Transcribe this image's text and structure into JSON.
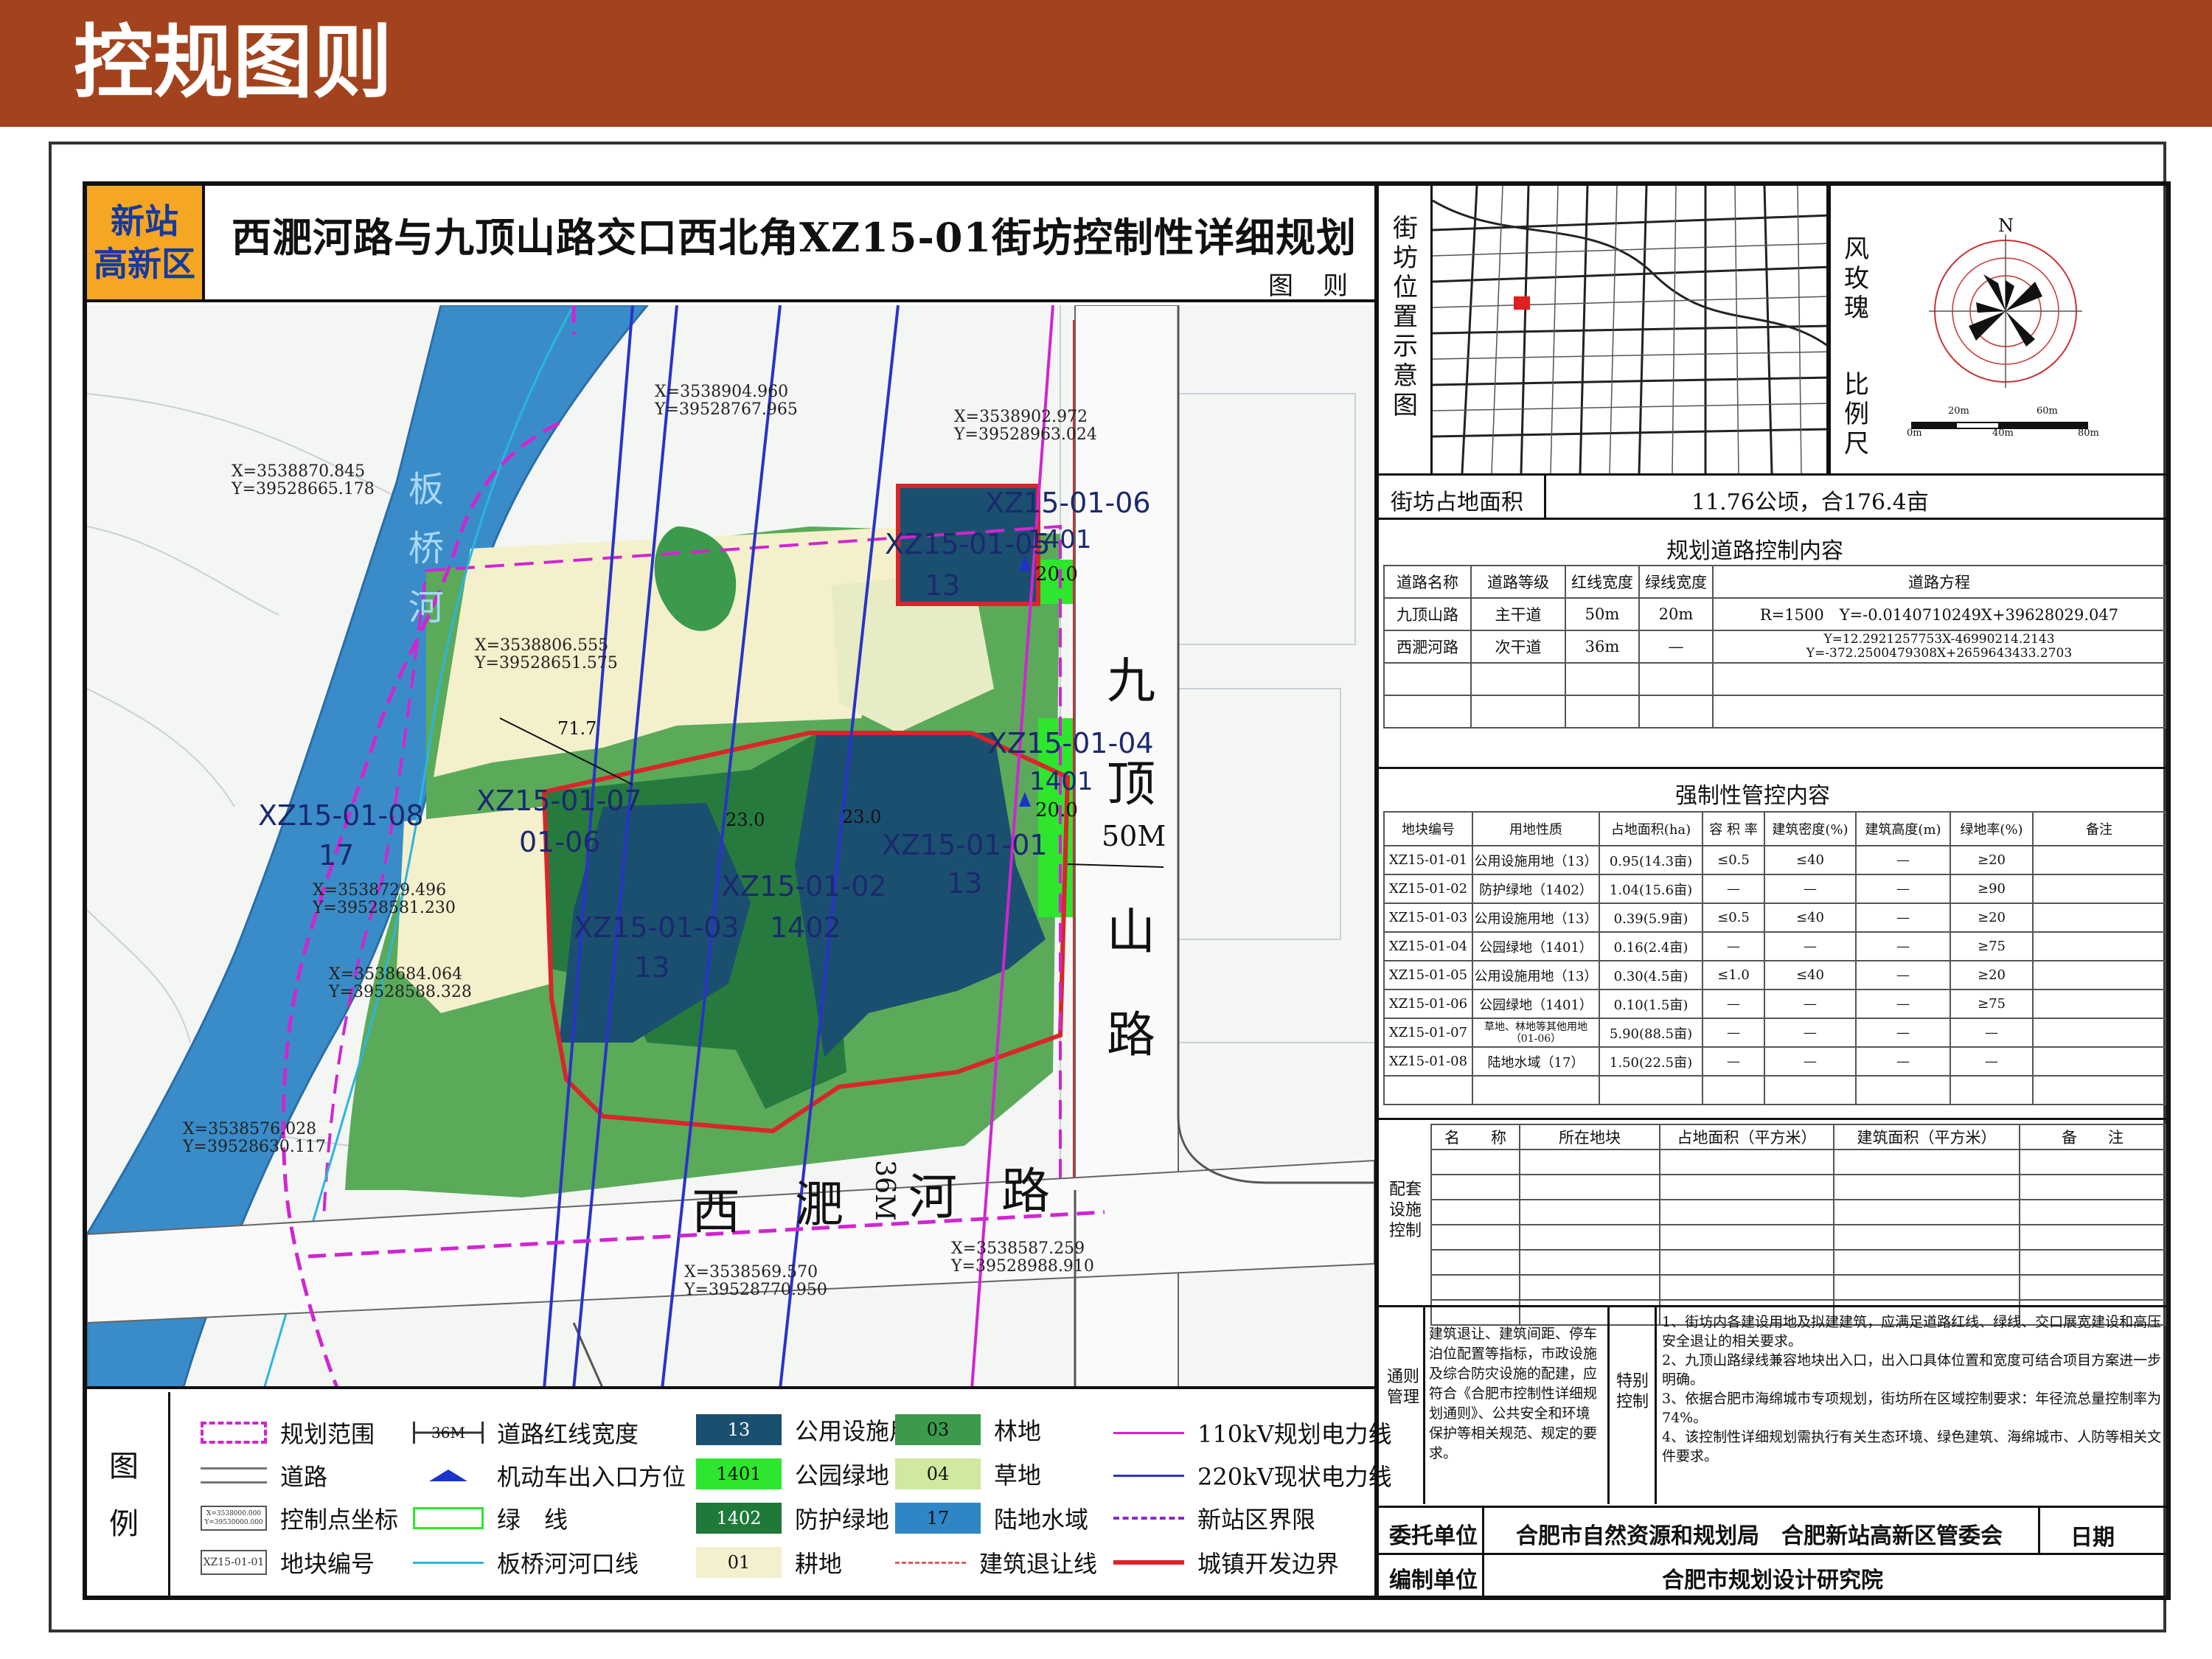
{
  "header": {
    "title": "控规图则"
  },
  "plan": {
    "badge_line1": "新站",
    "badge_line2": "高新区",
    "title": "西淝河路与九顶山路交口西北角XZ15-01街坊控制性详细规划",
    "subtitle": "图则"
  },
  "map": {
    "river_name": [
      "板",
      "桥",
      "河"
    ],
    "road_east": [
      "九",
      "顶",
      "山",
      "路"
    ],
    "road_east_width": "50M",
    "road_south": [
      "西",
      "淝",
      "河",
      "路"
    ],
    "road_south_width": "36M",
    "zones": [
      {
        "code": "XZ15-01-01",
        "use": "13"
      },
      {
        "code": "XZ15-01-02",
        "use": "1402"
      },
      {
        "code": "XZ15-01-03",
        "use": "13"
      },
      {
        "code": "XZ15-01-04",
        "use": "1401"
      },
      {
        "code": "XZ15-01-05",
        "use": "13"
      },
      {
        "code": "XZ15-01-06",
        "use": "1401"
      },
      {
        "code": "XZ15-01-07",
        "use": "01-06"
      },
      {
        "code": "XZ15-01-08",
        "use": "17"
      }
    ],
    "dims": [
      "20.0",
      "20.0",
      "23.0",
      "23.0",
      "71.7"
    ],
    "coords": [
      {
        "x": "X=3538904.960",
        "y": "Y=39528767.965"
      },
      {
        "x": "X=3538902.972",
        "y": "Y=39528963.024"
      },
      {
        "x": "X=3538870.845",
        "y": "Y=39528665.178"
      },
      {
        "x": "X=3538806.555",
        "y": "Y=39528651.575"
      },
      {
        "x": "X=3538729.496",
        "y": "Y=39528581.230"
      },
      {
        "x": "X=3538684.064",
        "y": "Y=39528588.328"
      },
      {
        "x": "X=3538576.028",
        "y": "Y=39528630.117"
      },
      {
        "x": "X=3538569.570",
        "y": "Y=39528770.950"
      },
      {
        "x": "X=3538587.259",
        "y": "Y=39528988.910"
      }
    ]
  },
  "legend": {
    "title": [
      "图",
      "例"
    ],
    "items": [
      {
        "label": "规划范围",
        "swatch": "dashed-magenta"
      },
      {
        "label": "道路",
        "swatch": "road"
      },
      {
        "label": "控制点坐标",
        "swatch": "coord",
        "text": "X=3538000.000 Y=39530000.000"
      },
      {
        "label": "地块编号",
        "swatch": "code",
        "text": "XZ15-01-01"
      },
      {
        "label": "道路红线宽度",
        "swatch": "width",
        "text": "36M"
      },
      {
        "label": "机动车出入口方位",
        "swatch": "entrance"
      },
      {
        "label": "绿　线",
        "swatch": "greenline"
      },
      {
        "label": "板桥河河口线",
        "swatch": "riverline"
      },
      {
        "label": "公用设施用地",
        "swatch": "fill",
        "text": "13",
        "color": "#1b4f70"
      },
      {
        "label": "公园绿地",
        "swatch": "fill",
        "text": "1401",
        "color": "#2ee62e"
      },
      {
        "label": "防护绿地",
        "swatch": "fill",
        "text": "1402",
        "color": "#1f7a3a"
      },
      {
        "label": "耕地",
        "swatch": "fill",
        "text": "01",
        "color": "#f3f0cd"
      },
      {
        "label": "林地",
        "swatch": "fill",
        "text": "03",
        "color": "#3c9a4c"
      },
      {
        "label": "草地",
        "swatch": "fill",
        "text": "04",
        "color": "#cfe9a0"
      },
      {
        "label": "陆地水域",
        "swatch": "fill",
        "text": "17",
        "color": "#2f86c6"
      },
      {
        "label": "建筑退让线",
        "swatch": "setback"
      },
      {
        "label": "110kV规划电力线",
        "swatch": "power110"
      },
      {
        "label": "220kV现状电力线",
        "swatch": "power220"
      },
      {
        "label": "新站区界限",
        "swatch": "boundary"
      },
      {
        "label": "城镇开发边界",
        "swatch": "devline"
      }
    ]
  },
  "location": {
    "label": [
      "街",
      "坊",
      "位",
      "置",
      "示",
      "意",
      "图"
    ],
    "windrose_label": [
      "风",
      "玫",
      "瑰"
    ],
    "north": "N",
    "scale_label": [
      "比",
      "例",
      "尺"
    ],
    "scale_ticks": [
      "0m",
      "20m",
      "40m",
      "60m",
      "80m"
    ]
  },
  "area": {
    "label": "街坊占地面积",
    "value": "11.76公顷，合176.4亩"
  },
  "roads": {
    "title": "规划道路控制内容",
    "headers": [
      "道路名称",
      "道路等级",
      "红线宽度",
      "绿线宽度",
      "道路方程"
    ],
    "rows": [
      [
        "九顶山路",
        "主干道",
        "50m",
        "20m",
        "R=1500　Y=-0.0140710249X+39628029.047"
      ],
      [
        "西淝河路",
        "次干道",
        "36m",
        "—",
        "Y=12.2921257753X-46990214.2143 Y=-372.2500479308X+2659643433.2703"
      ]
    ]
  },
  "mandatory": {
    "title": "强制性管控内容",
    "headers": [
      "地块编号",
      "用地性质",
      "占地面积(ha)",
      "容 积 率",
      "建筑密度(%)",
      "建筑高度(m)",
      "绿地率(%)",
      "备注"
    ],
    "rows": [
      [
        "XZ15-01-01",
        "公用设施用地（13）",
        "0.95(14.3亩)",
        "≤0.5",
        "≤40",
        "—",
        "≥20",
        ""
      ],
      [
        "XZ15-01-02",
        "防护绿地（1402）",
        "1.04(15.6亩)",
        "—",
        "—",
        "—",
        "≥90",
        ""
      ],
      [
        "XZ15-01-03",
        "公用设施用地（13）",
        "0.39(5.9亩)",
        "≤0.5",
        "≤40",
        "—",
        "≥20",
        ""
      ],
      [
        "XZ15-01-04",
        "公园绿地（1401）",
        "0.16(2.4亩)",
        "—",
        "—",
        "—",
        "≥75",
        ""
      ],
      [
        "XZ15-01-05",
        "公用设施用地（13）",
        "0.30(4.5亩)",
        "≤1.0",
        "≤40",
        "—",
        "≥20",
        ""
      ],
      [
        "XZ15-01-06",
        "公园绿地（1401）",
        "0.10(1.5亩)",
        "—",
        "—",
        "—",
        "≥75",
        ""
      ],
      [
        "XZ15-01-07",
        "草地、林地等其他用地（01-06）",
        "5.90(88.5亩)",
        "—",
        "—",
        "—",
        "—",
        ""
      ],
      [
        "XZ15-01-08",
        "陆地水域（17）",
        "1.50(22.5亩)",
        "—",
        "—",
        "—",
        "—",
        ""
      ]
    ]
  },
  "facilities": {
    "label": [
      "配套",
      "设施",
      "控制"
    ],
    "headers": [
      "名　　称",
      "所在地块",
      "占地面积（平方米）",
      "建筑面积（平方米）",
      "备　　注"
    ]
  },
  "general": {
    "label": [
      "通则",
      "管理"
    ],
    "text": "建筑退让、建筑间距、停车泊位配置等指标，市政设施及综合防灾设施的配建，应符合《合肥市控制性详细规划通则》、公共安全和环境保护等相关规范、规定的要求。"
  },
  "special": {
    "label": [
      "特别",
      "控制"
    ],
    "items": [
      "1、街坊内各建设用地及拟建建筑，应满足道路红线、绿线、交口展宽建设和高压安全退让的相关要求。",
      "2、九顶山路绿线兼容地块出入口，出入口具体位置和宽度可结合项目方案进一步明确。",
      "3、依据合肥市海绵城市专项规划，街坊所在区域控制要求：年径流总量控制率为74%。",
      "4、该控制性详细规划需执行有关生态环境、绿色建筑、海绵城市、人防等相关文件要求。"
    ]
  },
  "footer": {
    "client_label": "委托单位",
    "client_value": "合肥市自然资源和规划局　合肥新站高新区管委会",
    "date_label": "日期",
    "compiler_label": "编制单位",
    "compiler_value": "合肥市规划设计研究院"
  }
}
